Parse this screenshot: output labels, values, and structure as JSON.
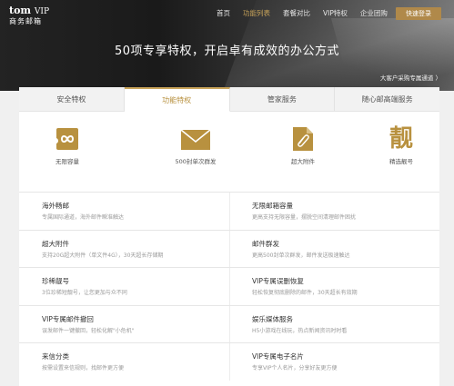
{
  "header": {
    "logo_top": "tom",
    "logo_vip": "VIP",
    "logo_bottom": "商务邮箱",
    "nav": [
      {
        "label": "首页",
        "active": false
      },
      {
        "label": "功能列表",
        "active": true
      },
      {
        "label": "套餐对比",
        "active": false
      },
      {
        "label": "VIP特权",
        "active": false
      },
      {
        "label": "企业团购",
        "active": false
      }
    ],
    "login_label": "快速登录"
  },
  "hero": {
    "title": "50项专享特权，开启卓有成效的办公方式",
    "link": "大客户采购专属通道 〉"
  },
  "tabs": [
    {
      "label": "安全特权",
      "active": false
    },
    {
      "label": "功能特权",
      "active": true
    },
    {
      "label": "管家服务",
      "active": false
    },
    {
      "label": "随心邮高端服务",
      "active": false
    }
  ],
  "features": [
    {
      "label": "无限容量",
      "icon": "infinity-icon"
    },
    {
      "label": "500封单次群发",
      "icon": "envelope-icon"
    },
    {
      "label": "超大附件",
      "icon": "paperclip-icon"
    },
    {
      "label": "精选靓号",
      "icon": "liang-char-icon",
      "glyph": "靓"
    }
  ],
  "colors": {
    "accent": "#c9a45a",
    "accent_dark": "#b0894a"
  },
  "list": [
    [
      {
        "title": "海外畅邮",
        "desc": "专属国际通道，海外邮件瞬准触达"
      },
      {
        "title": "无限邮箱容量",
        "desc": "更高支持无限容量，摆脱空间清理邮件困扰"
      }
    ],
    [
      {
        "title": "超大附件",
        "desc": "支持20G超大附件（单文件4G），30天超长存储期"
      },
      {
        "title": "邮件群发",
        "desc": "更高500封单次群发，邮件发送极速触达"
      }
    ],
    [
      {
        "title": "珍稀靓号",
        "desc": "3位珍稀短靓号，让您更加与众不同"
      },
      {
        "title": "VIP专属误删恢复",
        "desc": "轻松恢复彻底删除的邮件，30天超长有效期"
      }
    ],
    [
      {
        "title": "VIP专属邮件撤回",
        "desc": "误发邮件一键撤回，轻松化解\"小危机\""
      },
      {
        "title": "娱乐媒体服务",
        "desc": "H5小游戏在线玩，热点新闻资讯时时看"
      }
    ],
    [
      {
        "title": "来信分类",
        "desc": "按需设置来信规则，找邮件更方便"
      },
      {
        "title": "VIP专属电子名片",
        "desc": "专享VIP个人名片，分享好友更方便"
      }
    ]
  ]
}
